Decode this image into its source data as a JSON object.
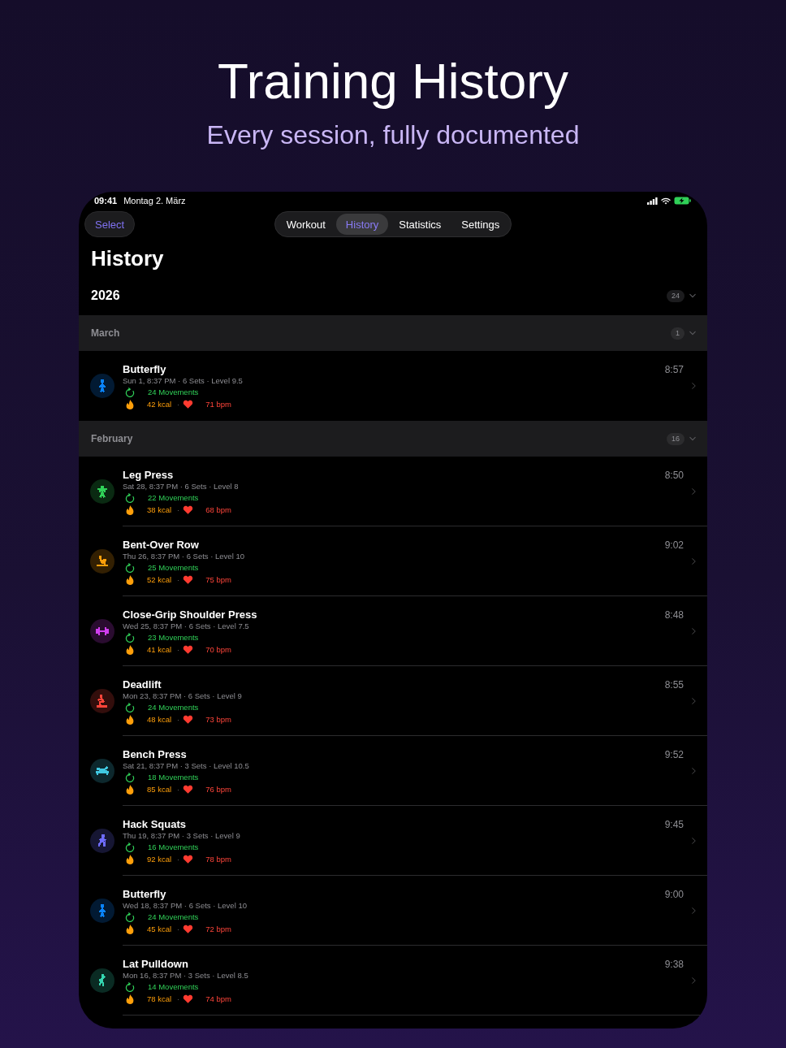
{
  "hero": {
    "title": "Training History",
    "subtitle": "Every session, fully documented"
  },
  "status_bar": {
    "time": "09:41",
    "date": "Montag 2. März"
  },
  "toolbar": {
    "select_button": "Select",
    "tabs": [
      {
        "label": "Workout",
        "selected": false
      },
      {
        "label": "History",
        "selected": true
      },
      {
        "label": "Statistics",
        "selected": false
      },
      {
        "label": "Settings",
        "selected": false
      }
    ]
  },
  "page_title": "History",
  "year_section": {
    "year": "2026",
    "count": "24",
    "expanded": true
  },
  "months": [
    {
      "name": "March",
      "count": "1",
      "expanded": true,
      "workouts": [
        {
          "kind": "standing",
          "color": "#0a84ff",
          "name": "Butterfly",
          "details": "Sun 1, 8:37 PM · 6 Sets · Level 9.5",
          "movements": "24 Movements",
          "kcal": "42 kcal",
          "separator": "·",
          "bpm": "71 bpm",
          "duration": "8:57"
        }
      ]
    },
    {
      "name": "February",
      "count": "16",
      "expanded": true,
      "workouts": [
        {
          "kind": "strength",
          "color": "#30d158",
          "name": "Leg Press",
          "details": "Sat 28, 8:37 PM · 6 Sets · Level 8",
          "movements": "22 Movements",
          "kcal": "38 kcal",
          "separator": "·",
          "bpm": "68 bpm",
          "duration": "8:50"
        },
        {
          "kind": "rowing",
          "color": "#ff9f0a",
          "name": "Bent-Over Row",
          "details": "Thu 26, 8:37 PM · 6 Sets · Level 10",
          "movements": "25 Movements",
          "kcal": "52 kcal",
          "separator": "·",
          "bpm": "75 bpm",
          "duration": "9:02"
        },
        {
          "kind": "dumbbell",
          "color": "#d13ef0",
          "name": "Close-Grip Shoulder Press",
          "details": "Wed 25, 8:37 PM · 6 Sets · Level 7.5",
          "movements": "23 Movements",
          "kcal": "41 kcal",
          "separator": "·",
          "bpm": "70 bpm",
          "duration": "8:48"
        },
        {
          "kind": "squat",
          "color": "#ff453a",
          "name": "Deadlift",
          "details": "Mon 23, 8:37 PM · 6 Sets · Level 9",
          "movements": "24 Movements",
          "kcal": "48 kcal",
          "separator": "·",
          "bpm": "73 bpm",
          "duration": "8:55"
        },
        {
          "kind": "bench",
          "color": "#40c8e0",
          "name": "Bench Press",
          "details": "Sat 21, 8:37 PM · 3 Sets · Level 10.5",
          "movements": "18 Movements",
          "kcal": "85 kcal",
          "separator": "·",
          "bpm": "76 bpm",
          "duration": "9:52"
        },
        {
          "kind": "lunge",
          "color": "#6e6cff",
          "name": "Hack Squats",
          "details": "Thu 19, 8:37 PM · 3 Sets · Level 9",
          "movements": "16 Movements",
          "kcal": "92 kcal",
          "separator": "·",
          "bpm": "78 bpm",
          "duration": "9:45"
        },
        {
          "kind": "standing",
          "color": "#0a84ff",
          "name": "Butterfly",
          "details": "Wed 18, 8:37 PM · 6 Sets · Level 10",
          "movements": "24 Movements",
          "kcal": "45 kcal",
          "separator": "·",
          "bpm": "72 bpm",
          "duration": "9:00"
        },
        {
          "kind": "climb",
          "color": "#34d6b0",
          "name": "Lat Pulldown",
          "details": "Mon 16, 8:37 PM · 3 Sets · Level 8.5",
          "movements": "14 Movements",
          "kcal": "78 kcal",
          "separator": "·",
          "bpm": "74 bpm",
          "duration": "9:38"
        }
      ]
    }
  ]
}
